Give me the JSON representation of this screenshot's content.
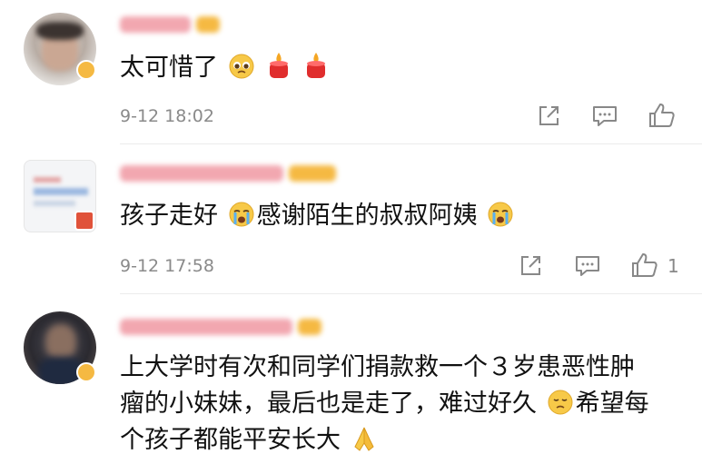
{
  "comments": [
    {
      "name": "",
      "text_1": "太可惜了",
      "time": "9-12 18:02",
      "like_count": ""
    },
    {
      "name": "",
      "text_1": "孩子走好",
      "text_2": "感谢陌生的叔叔阿姨",
      "time": "9-12 17:58",
      "like_count": "1"
    },
    {
      "name": "",
      "line_1": "上大学时有次和同学们捐款救一个３岁患恶性肿",
      "line_2a": "瘤的小妹妹，最后也是走了，难过好久",
      "line_2b": "希望每",
      "line_3": "个孩子都能平安长大"
    }
  ],
  "colors": {
    "name_pink": "#f2a7b0",
    "badge_orange": "#f5a623",
    "badge_red": "#e0523a",
    "icon_gray": "#888888",
    "time_gray": "#8a8a8a"
  },
  "icons": [
    "share-icon",
    "comment-icon",
    "like-icon",
    "pleading-face-emoji",
    "candle-emoji",
    "crying-face-emoji",
    "sad-face-emoji",
    "praying-hands-emoji"
  ]
}
